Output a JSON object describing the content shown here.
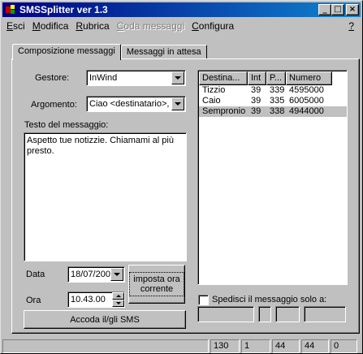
{
  "window": {
    "title": "SMSSplitter ver 1.3",
    "buttons": {
      "minimize": "_",
      "maximize": "□",
      "close": "×"
    }
  },
  "menu": {
    "items": [
      {
        "label": "Esci",
        "enabled": true
      },
      {
        "label": "Modifica",
        "enabled": true
      },
      {
        "label": "Rubrica",
        "enabled": true
      },
      {
        "label": "Coda messaggi",
        "enabled": false
      },
      {
        "label": "Configura",
        "enabled": true
      }
    ],
    "help": "?"
  },
  "tabs": [
    {
      "label": "Composizione messaggi",
      "active": true
    },
    {
      "label": "Messaggi in attesa",
      "active": false
    }
  ],
  "form": {
    "gestore_label": "Gestore:",
    "gestore_value": "InWind",
    "argomento_label": "Argomento:",
    "argomento_value": "Ciao <destinatario>, s",
    "testo_label": "Testo del messaggio:",
    "testo_value": "Aspetto tue notizzie. Chiamami al più presto.",
    "data_label": "Data",
    "data_value": "18/07/200",
    "ora_label": "Ora",
    "ora_value": "10.43.00",
    "imposta_button": "imposta ora corrente",
    "accoda_button": "Accoda il/gli SMS"
  },
  "contacts": {
    "columns": [
      "Destina...",
      "Int",
      "P...",
      "Numero"
    ],
    "rows": [
      {
        "name": "Tizzio",
        "int": "39",
        "prefix": "339",
        "number": "4595000",
        "selected": false
      },
      {
        "name": "Caio",
        "int": "39",
        "prefix": "335",
        "number": "6005000",
        "selected": false
      },
      {
        "name": "Sempronio",
        "int": "39",
        "prefix": "338",
        "number": "4944000",
        "selected": true
      }
    ]
  },
  "send_only": {
    "label": "Spedisci il messaggio solo a:",
    "checked": false
  },
  "statusbar": {
    "panels": [
      "",
      "130",
      "1",
      "44",
      "44",
      "0"
    ]
  }
}
